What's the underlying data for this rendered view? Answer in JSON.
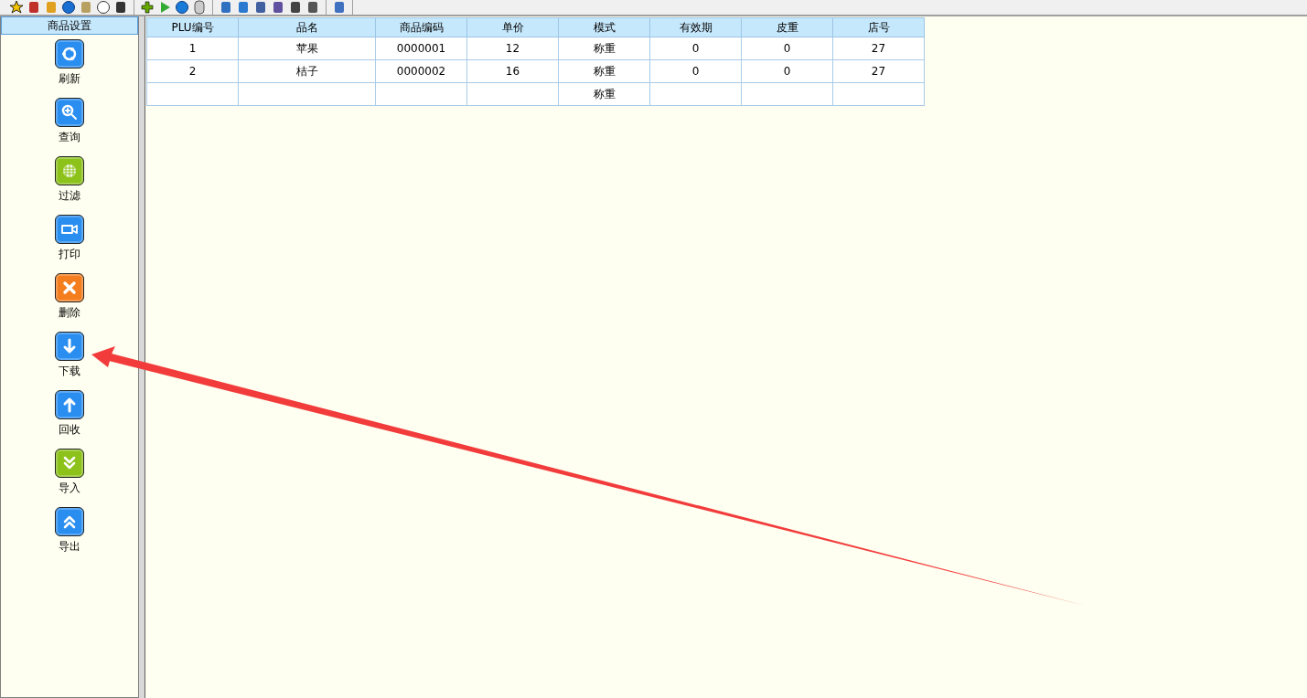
{
  "sidebar": {
    "title": "商品设置",
    "items": [
      {
        "label": "刷新",
        "color": "#2a8ef0"
      },
      {
        "label": "查询",
        "color": "#2a8ef0"
      },
      {
        "label": "过滤",
        "color": "#8cc21a"
      },
      {
        "label": "打印",
        "color": "#2a8ef0"
      },
      {
        "label": "删除",
        "color": "#f47d1e"
      },
      {
        "label": "下载",
        "color": "#2a8ef0"
      },
      {
        "label": "回收",
        "color": "#2a8ef0"
      },
      {
        "label": "导入",
        "color": "#8cc21a"
      },
      {
        "label": "导出",
        "color": "#2a8ef0"
      }
    ]
  },
  "table": {
    "columns": [
      "PLU编号",
      "品名",
      "商品编码",
      "单价",
      "模式",
      "有效期",
      "皮重",
      "店号"
    ],
    "rows": [
      [
        "1",
        "苹果",
        "0000001",
        "12",
        "称重",
        "0",
        "0",
        "27"
      ],
      [
        "2",
        "桔子",
        "0000002",
        "16",
        "称重",
        "0",
        "0",
        "27"
      ],
      [
        null,
        null,
        null,
        null,
        "称重",
        null,
        null,
        null
      ]
    ]
  }
}
